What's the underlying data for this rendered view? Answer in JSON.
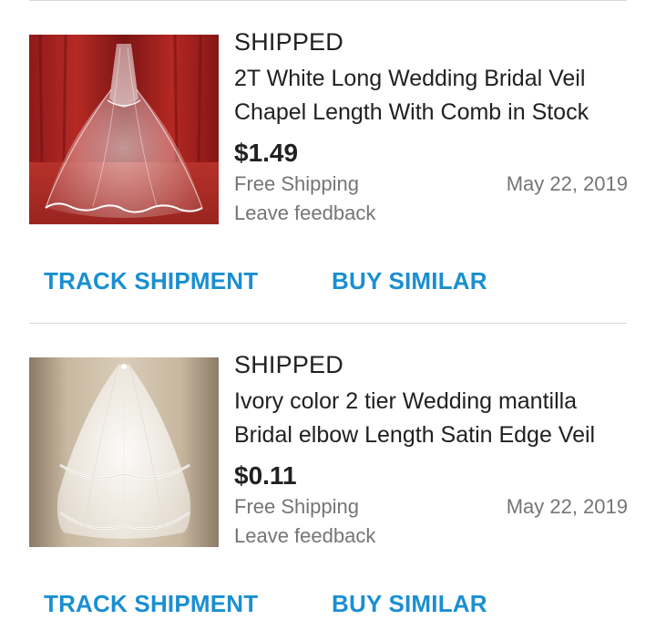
{
  "orders": [
    {
      "status": "SHIPPED",
      "title": "2T White Long Wedding Bridal Veil Chapel Length With Comb in Stock",
      "price": "$1.49",
      "shipping": "Free Shipping",
      "date": "May 22, 2019",
      "feedback": "Leave feedback",
      "track_label": "TRACK SHIPMENT",
      "similar_label": "BUY SIMILAR",
      "image": "long-white-veil-red-curtain"
    },
    {
      "status": "SHIPPED",
      "title": "Ivory color 2 tier Wedding mantilla Bridal elbow Length Satin Edge Veil",
      "price": "$0.11",
      "shipping": "Free Shipping",
      "date": "May 22, 2019",
      "feedback": "Leave feedback",
      "track_label": "TRACK SHIPMENT",
      "similar_label": "BUY SIMILAR",
      "image": "two-tier-white-veil-beige-background"
    }
  ],
  "colors": {
    "action": "#1a8fd1",
    "secondary_text": "#757575",
    "divider": "#d9d9d9"
  }
}
